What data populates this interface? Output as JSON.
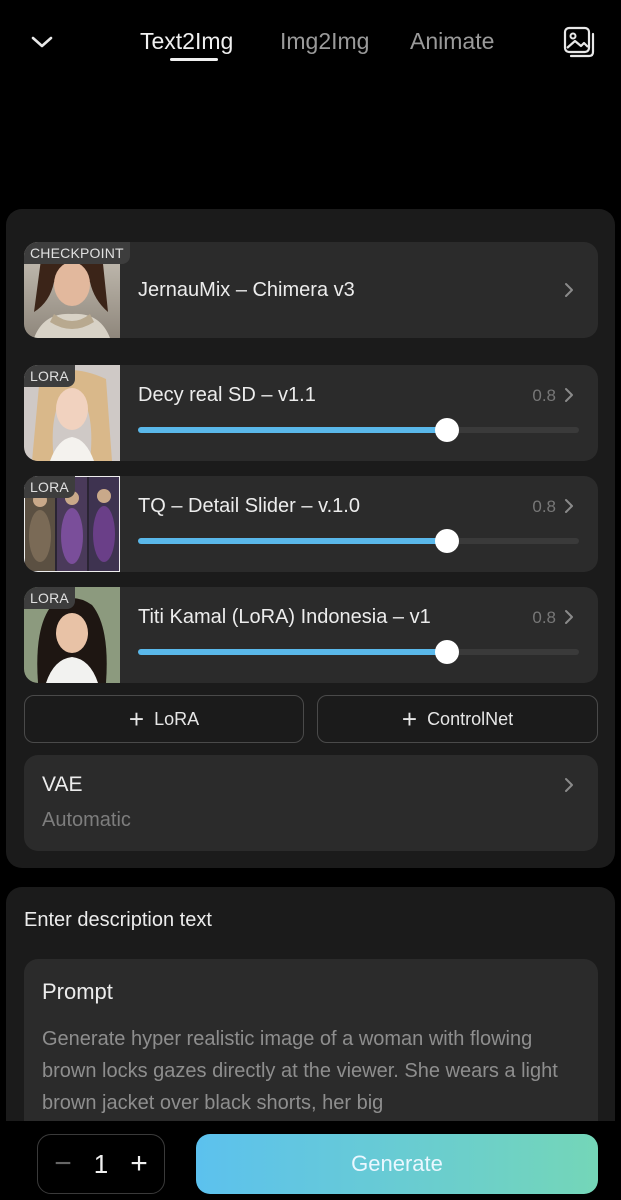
{
  "header": {
    "tabs": [
      {
        "label": "Text2Img",
        "active": true
      },
      {
        "label": "Img2Img",
        "active": false
      },
      {
        "label": "Animate",
        "active": false
      }
    ]
  },
  "models": {
    "checkpoint": {
      "badge": "CHECKPOINT",
      "name": "JernauMix – Chimera v3"
    },
    "loras": [
      {
        "badge": "LORA",
        "name": "Decy real SD – v1.1",
        "weight": "0.8",
        "level": 0.7
      },
      {
        "badge": "LORA",
        "name": "TQ – Detail Slider – v.1.0",
        "weight": "0.8",
        "level": 0.7
      },
      {
        "badge": "LORA",
        "name": "Titi Kamal (LoRA) Indonesia – v1",
        "weight": "0.8",
        "level": 0.7
      }
    ],
    "add_lora_label": "LoRA",
    "add_controlnet_label": "ControlNet",
    "vae": {
      "title": "VAE",
      "value": "Automatic"
    }
  },
  "prompt_section": {
    "header": "Enter description text",
    "title": "Prompt",
    "text": "Generate hyper realistic image of a woman with flowing brown locks gazes directly at the viewer. She wears a light brown jacket over black shorts, her big"
  },
  "bottom": {
    "count": "1",
    "generate_label": "Generate"
  },
  "colors": {
    "slider_fill": "#5ab8ea",
    "generate_gradient_start": "#5cc1ee",
    "generate_gradient_end": "#74d6b8"
  }
}
